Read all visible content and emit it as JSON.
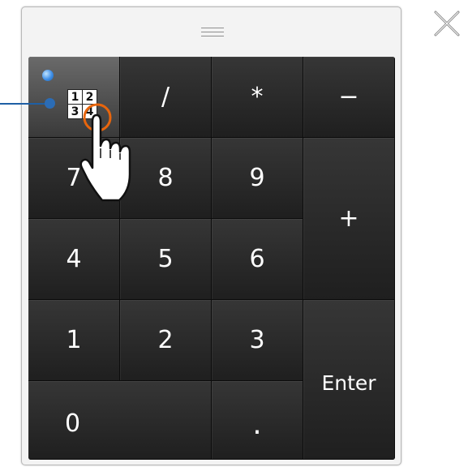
{
  "keypad": {
    "toggle": {
      "cells": [
        "1",
        "2",
        "3",
        "4"
      ]
    },
    "keys": {
      "divide": "/",
      "multiply": "*",
      "minus": "−",
      "seven": "7",
      "eight": "8",
      "nine": "9",
      "plus": "+",
      "four": "4",
      "five": "5",
      "six": "6",
      "one": "1",
      "two": "2",
      "three": "3",
      "enter": "Enter",
      "zero": "0",
      "dot": "."
    }
  },
  "colors": {
    "key_background": "#262626",
    "toggle_background": "#4a4a4a",
    "key_text": "#ffffff",
    "indicator": "#3f8fe8",
    "callout": "#1e5fa5",
    "highlight_ring": "#e8650c",
    "window_frame": "#f3f3f3"
  },
  "icons": {
    "close": "close-x-icon",
    "grip": "drag-grip-icon",
    "toggle": "numeric-grid-icon",
    "pointer": "hand-pointer-icon",
    "indicator": "led-indicator-icon"
  }
}
